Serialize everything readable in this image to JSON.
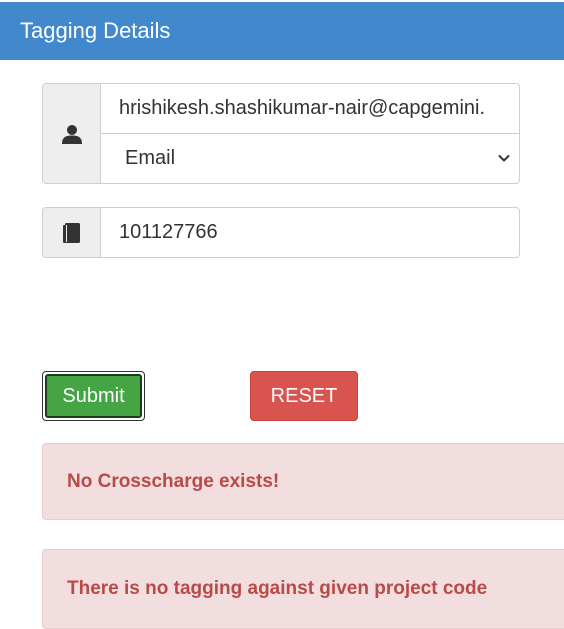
{
  "header": {
    "title": "Tagging Details"
  },
  "form": {
    "user_icon": "user-icon",
    "email_value": "hrishikesh.shashikumar-nair@capgemini.",
    "id_type_selected": "Email",
    "book_icon": "book-icon",
    "project_code_value": "101127766"
  },
  "buttons": {
    "submit_label": "Submit",
    "reset_label": "RESET"
  },
  "alerts": {
    "crosscharge": "No Crosscharge exists!",
    "tagging": "There is no tagging against given project code"
  },
  "colors": {
    "header_bg": "#4288cc",
    "submit_bg": "#45a545",
    "reset_bg": "#d9534f",
    "alert_bg": "#f2dede",
    "alert_text": "#b94a48"
  }
}
